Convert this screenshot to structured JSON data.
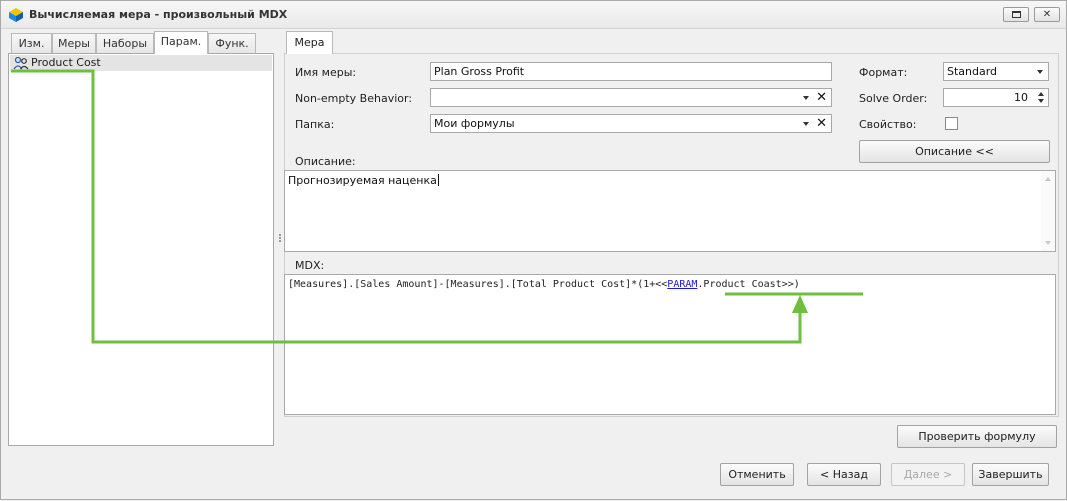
{
  "window": {
    "title": "Вычисляемая мера - произвольный MDX"
  },
  "left_panel": {
    "tabs": [
      {
        "label": "Изм."
      },
      {
        "label": "Меры"
      },
      {
        "label": "Наборы"
      },
      {
        "label": "Парам."
      },
      {
        "label": "Функ."
      }
    ],
    "active_tab": "Парам.",
    "items": [
      {
        "label": "Product Cost",
        "icon": "parameter-icon"
      }
    ]
  },
  "right_panel": {
    "tab_label": "Мера",
    "name": {
      "label": "Имя меры:",
      "value": "Plan Gross Profit"
    },
    "nonempty": {
      "label": "Non-empty Behavior:",
      "value": ""
    },
    "folder": {
      "label": "Папка:",
      "value": "Мои формулы"
    },
    "format": {
      "label": "Формат:",
      "value": "Standard"
    },
    "solve_order": {
      "label": "Solve Order:",
      "value": "10"
    },
    "property": {
      "label": "Свойство:",
      "checked": false
    },
    "description_toggle": "Описание <<",
    "description": {
      "label": "Описание:",
      "value": "Прогнозируемая наценка"
    },
    "mdx": {
      "label": "MDX:",
      "prefix": "[Measures].[Sales Amount]-[Measures].[Total Product Cost]*(1+<<",
      "param_keyword": "PARAM",
      "param_rest": ".Product Coast",
      "suffix": ">>)"
    },
    "check_button": "Проверить формулу"
  },
  "footer": {
    "cancel": "Отменить",
    "back": "< Назад",
    "next": "Далее >",
    "finish": "Завершить"
  },
  "colors": {
    "annotation": "#6fbf3f",
    "param_link": "#1a1ad0"
  }
}
